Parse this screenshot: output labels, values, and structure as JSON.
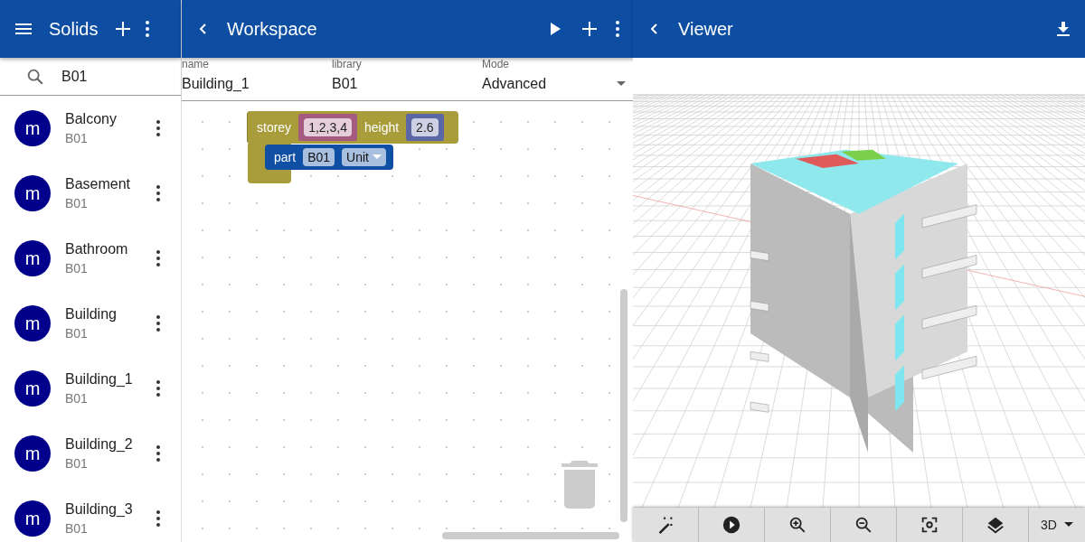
{
  "solids_panel": {
    "title": "Solids",
    "search": {
      "value": "B01"
    },
    "items": [
      {
        "avatar": "m",
        "name": "Balcony",
        "library": "B01"
      },
      {
        "avatar": "m",
        "name": "Basement",
        "library": "B01"
      },
      {
        "avatar": "m",
        "name": "Bathroom",
        "library": "B01"
      },
      {
        "avatar": "m",
        "name": "Building",
        "library": "B01"
      },
      {
        "avatar": "m",
        "name": "Building_1",
        "library": "B01"
      },
      {
        "avatar": "m",
        "name": "Building_2",
        "library": "B01"
      },
      {
        "avatar": "m",
        "name": "Building_3",
        "library": "B01"
      }
    ]
  },
  "workspace": {
    "title": "Workspace",
    "fields": [
      {
        "label": "name",
        "value": "Building_1",
        "kind": "text"
      },
      {
        "label": "library",
        "value": "B01",
        "kind": "text"
      },
      {
        "label": "Mode",
        "value": "Advanced",
        "kind": "select"
      }
    ],
    "blocks": {
      "storey_label": "storey",
      "storey_value": "1,2,3,4",
      "height_label": "height",
      "height_value": "2.6",
      "part_label": "part",
      "part_value": "B01",
      "part_type": "Unit"
    }
  },
  "viewer": {
    "title": "Viewer",
    "view_mode": "3D"
  }
}
